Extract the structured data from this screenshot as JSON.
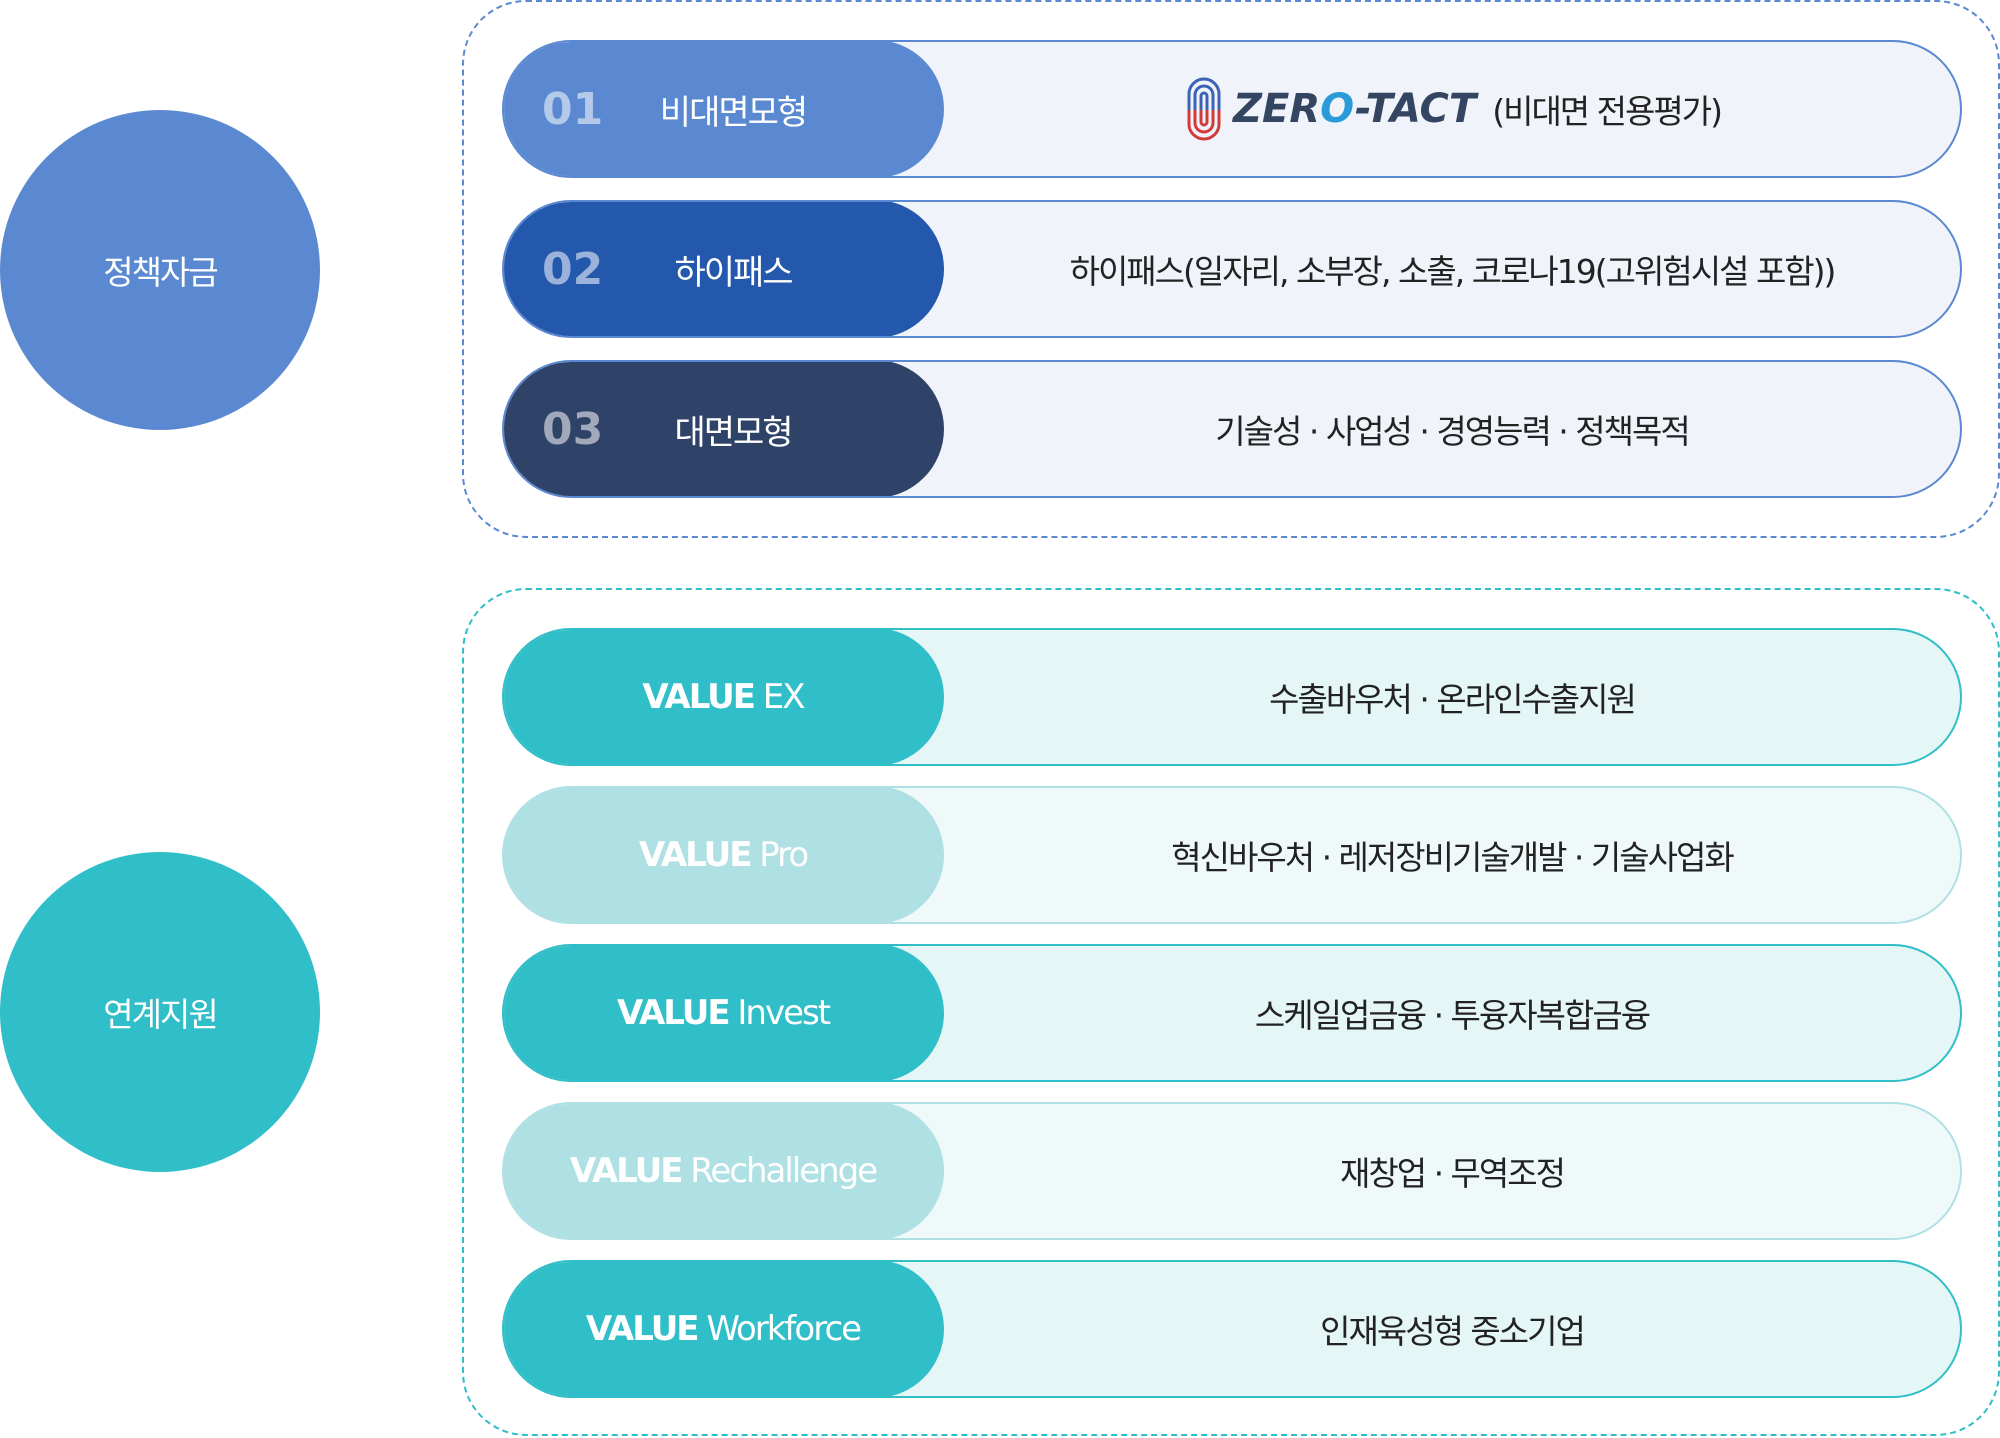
{
  "policy": {
    "label": "정책자금",
    "color": "#5b89d1",
    "rows": [
      {
        "num": "01",
        "label": "비대면모형",
        "logo_text": "ZERO-TACT",
        "desc": "(비대면 전용평가)",
        "color": "#5b89d1"
      },
      {
        "num": "02",
        "label": "하이패스",
        "desc": "하이패스(일자리, 소부장, 소출, 코로나19(고위험시설 포함))",
        "color": "#2358ad"
      },
      {
        "num": "03",
        "label": "대면모형",
        "desc": "기술성 · 사업성 · 경영능력 · 정책목적",
        "color": "#2f4268"
      }
    ]
  },
  "linked": {
    "label": "연계지원",
    "color": "#30bec8",
    "rows": [
      {
        "bold": "VALUE",
        "rest": " EX",
        "desc": "수출바우처 · 온라인수출지원"
      },
      {
        "bold": "VALUE",
        "rest": " Pro",
        "desc": "혁신바우처 · 레저장비기술개발 · 기술사업화"
      },
      {
        "bold": "VALUE",
        "rest": " Invest",
        "desc": "스케일업금융 · 투융자복합금융"
      },
      {
        "bold": "VALUE",
        "rest": " Rechallenge",
        "desc": "재창업 · 무역조정"
      },
      {
        "bold": "VALUE",
        "rest": " Workforce",
        "desc": "인재육성형 중소기업"
      }
    ]
  }
}
